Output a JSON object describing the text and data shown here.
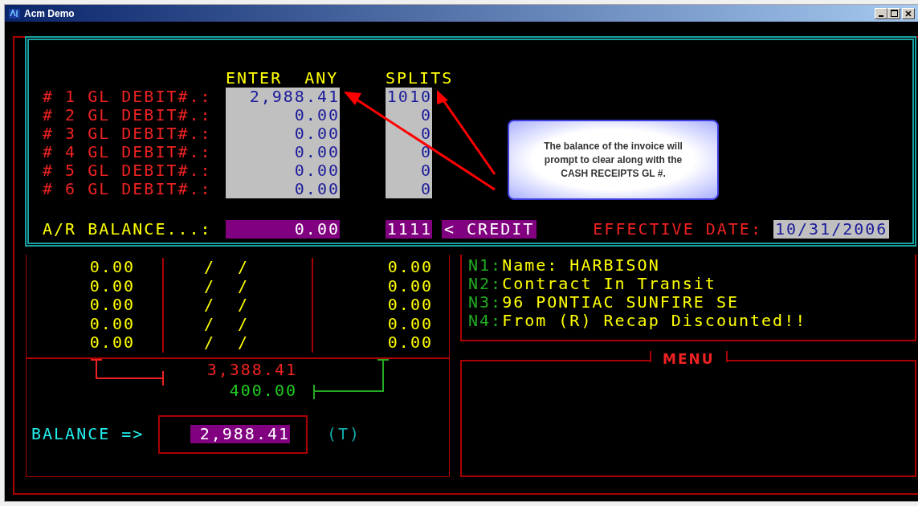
{
  "window": {
    "title": "Acm Demo"
  },
  "splits_header": {
    "amount": "ENTER  ANY",
    "split": "SPLITS"
  },
  "debit_rows": [
    {
      "label": "# 1 GL DEBIT#.:",
      "amount": "2,988.41",
      "split": "1010"
    },
    {
      "label": "# 2 GL DEBIT#.:",
      "amount": "0.00",
      "split": "0"
    },
    {
      "label": "# 3 GL DEBIT#.:",
      "amount": "0.00",
      "split": "0"
    },
    {
      "label": "# 4 GL DEBIT#.:",
      "amount": "0.00",
      "split": "0"
    },
    {
      "label": "# 5 GL DEBIT#.:",
      "amount": "0.00",
      "split": "0"
    },
    {
      "label": "# 6 GL DEBIT#.:",
      "amount": "0.00",
      "split": "0"
    }
  ],
  "ar_balance": {
    "label": "A/R BALANCE...:",
    "amount": "0.00",
    "account": "1111",
    "side": "< CREDIT"
  },
  "effective_date": {
    "label": "EFFECTIVE DATE:",
    "value": "10/31/2006"
  },
  "callout": {
    "text": "The balance of the invoice will prompt to clear along with the CASH RECEIPTS GL #."
  },
  "ledger_rows": [
    {
      "amount": "0.00",
      "date": "/  /",
      "amount_2": "0.00"
    },
    {
      "amount": "0.00",
      "date": "/  /",
      "amount_2": "0.00"
    },
    {
      "amount": "0.00",
      "date": "/  /",
      "amount_2": "0.00"
    },
    {
      "amount": "0.00",
      "date": "/  /",
      "amount_2": "0.00"
    },
    {
      "amount": "0.00",
      "date": "/  /",
      "amount_2": "0.00"
    }
  ],
  "totals": {
    "debit": "3,388.41",
    "credit": "400.00"
  },
  "balance": {
    "label": "BALANCE =>",
    "value": "2,988.41",
    "flag": "(T)"
  },
  "notes": [
    {
      "code": "N1:",
      "text": "Name: HARBISON"
    },
    {
      "code": "N2:",
      "text": "Contract In Transit"
    },
    {
      "code": "N3:",
      "text": "96 PONTIAC SUNFIRE SE"
    },
    {
      "code": "N4:",
      "text": "From (R) Recap Discounted!!"
    }
  ],
  "menu": {
    "title": "MENU"
  }
}
